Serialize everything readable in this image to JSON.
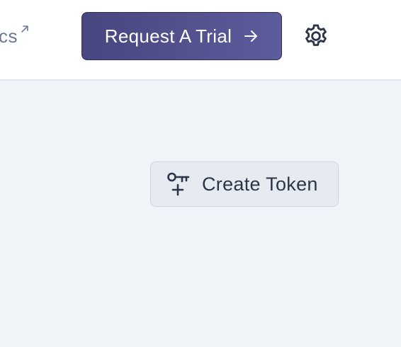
{
  "header": {
    "docs_link_label": "cs",
    "docs_link_icon": "external-link-icon",
    "trial_button_label": "Request A Trial",
    "trial_button_icon": "arrow-right-icon",
    "settings_icon": "gear-icon"
  },
  "main": {
    "create_token_label": "Create Token",
    "create_token_icon": "key-plus-icon"
  },
  "colors": {
    "trial_button": "#4f4d8a",
    "page_background": "#f0f3f8",
    "header_background": "#ffffff",
    "text_dark": "#2d3648",
    "link_muted": "#6e7a92"
  }
}
